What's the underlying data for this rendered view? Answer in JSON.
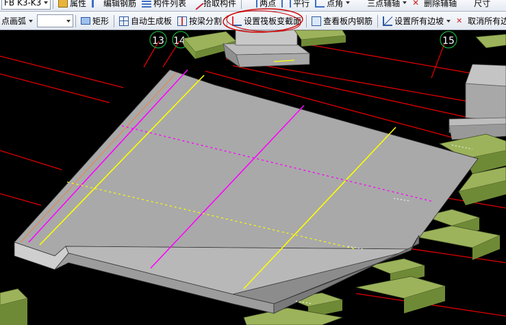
{
  "toolbar1": {
    "combo_label": "FB K3-K3",
    "items": [
      "属性",
      "编辑钢筋",
      "构件列表",
      "拾取构件",
      "两点",
      "平行",
      "点角",
      "三点辅轴",
      "删除辅轴",
      "尺寸"
    ]
  },
  "toolbar2": {
    "arc_label": "点画弧",
    "arc_value": "",
    "rect_label": "矩形",
    "auto_generate_label": "自动生成板",
    "split_by_beam_label": "按梁分割",
    "set_raft_section_label": "设置筏板变截面",
    "view_rebar_label": "查看板内钢筋",
    "set_all_slopes_label": "设置所有边坡",
    "cancel_all_slopes_label": "取消所有边坡"
  },
  "axis_labels": [
    "13",
    "14",
    "15"
  ],
  "colors": {
    "slab_top": "#aaaaaa",
    "slab_side": "#cfcfcf",
    "slab_front": "#8c8c8c",
    "pile_cap": "#9cb35b",
    "axis_line": "#e00000",
    "magenta_rebar": "#ff00ff",
    "yellow_rebar": "#ffff00",
    "annotation_circle": "#cc0000"
  }
}
